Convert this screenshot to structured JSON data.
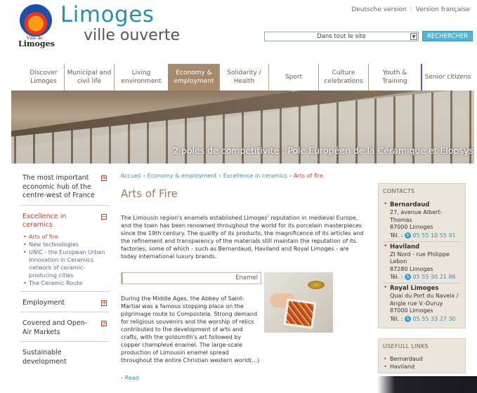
{
  "logo": {
    "ville": "Ville de",
    "name": "Limoges"
  },
  "brand": {
    "line1": "Limoges",
    "line2": "ville ouverte"
  },
  "lang": {
    "deutsch": "Deutsche version",
    "francais": "Version française"
  },
  "search": {
    "scope": "Dans tout le site",
    "button": "RECHERCHER"
  },
  "nav": [
    "Discover Limoges",
    "Municipal and civil life",
    "Living environment",
    "Economy & employment",
    "Solidarity / Health",
    "Sport",
    "Culture celebrations",
    "Youth & Training",
    "Senior citizens"
  ],
  "banner": {
    "caption": "2 pôles de compétitivité : Pole Européen de la Céramique et Elopsys"
  },
  "sidebar": {
    "hub": "The most important economic hub of the centre-west of France",
    "ceramics": "Excellence in ceramics",
    "ceramics_items": [
      "Arts of fire",
      "New technologies",
      "UNIC - the European Urban Innovation in Ceramics network of ceramic-producing cities",
      "The Ceramic Route"
    ],
    "employment": "Employment",
    "markets": "Covered and Open-Air Markets",
    "sustainable": "Sustainable development"
  },
  "breadcrumb": [
    "Accueil",
    "Economy & employment",
    "Excellence in ceramics",
    "Arts of fire"
  ],
  "main": {
    "title": "Arts of Fire",
    "intro": "The Limousin region's enamels established Limoges' reputation in medieval Europe, and the town has been renowned throughout the world for its porcelain masterpieces since the 19th century. The quality of its products, the magnificence of its articles and the refinement and transparency of the materials still maintain the reputation of its factories, some of which - such as Bernardaud, Haviland and Royal Limoges - are today international luxury brands.",
    "enamel_tab": "Enamel",
    "body": "During the Middle Ages, the Abbey of Saint-Martial was a famous stopping place on the pilgrimage route to Compostela. Strong demand for religious souvenirs and the worship of relics contributed to the development of arts and crafts, with the goldsmith's art followed by copper champlevé enamel. The large-scale production of Limousin enamel spread throughout the entire Christian western world(...)",
    "read": "› Read"
  },
  "contacts": {
    "title": "CONTACTS",
    "items": [
      {
        "name": "Bernardaud",
        "lines": [
          "27, avenue Albert-Thomas",
          "87000 Limoges"
        ],
        "tel_label": "Tél. :",
        "tel": "05 55 10 55 91"
      },
      {
        "name": "Haviland",
        "lines": [
          "ZI Nord - rue Philippe Lebon",
          "87280 Limoges"
        ],
        "tel_label": "Tél. :",
        "tel": "05 55 30 21 86"
      },
      {
        "name": "Royal Limoges",
        "lines": [
          "Quai du Port du Naveix /",
          "Angle rue V.-Duruy",
          "87000 Limoges"
        ],
        "tel_label": "Tél. :",
        "tel": "05 55 33 27 30"
      }
    ]
  },
  "useful": {
    "title": "USEFULL LINKS",
    "items": [
      "Bernardaud",
      "Haviland"
    ]
  }
}
